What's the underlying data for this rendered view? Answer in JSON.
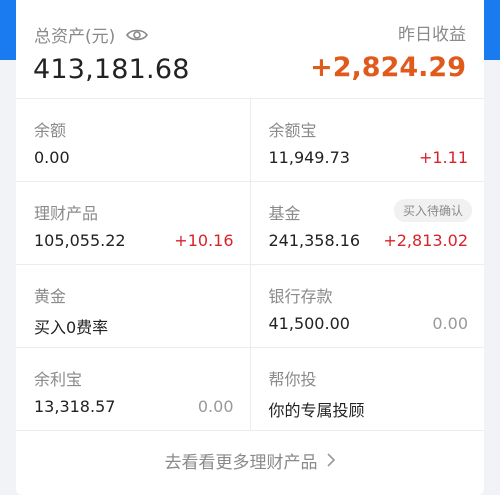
{
  "summary": {
    "total_label": "总资产(元)",
    "total_value": "413,181.68",
    "yesterday_label": "昨日收益",
    "yesterday_value": "+2,824.29"
  },
  "items": [
    {
      "name": "余额",
      "value": "0.00",
      "change": "",
      "change_type": "none"
    },
    {
      "name": "余额宝",
      "value": "11,949.73",
      "change": "+1.11",
      "change_type": "up"
    },
    {
      "name": "理财产品",
      "value": "105,055.22",
      "change": "+10.16",
      "change_type": "up"
    },
    {
      "name": "基金",
      "value": "241,358.16",
      "change": "+2,813.02",
      "change_type": "up",
      "badge": "买入待确认"
    },
    {
      "name": "黄金",
      "value": "买入0费率",
      "change": "",
      "change_type": "none"
    },
    {
      "name": "银行存款",
      "value": "41,500.00",
      "change": "0.00",
      "change_type": "flat"
    },
    {
      "name": "余利宝",
      "value": "13,318.57",
      "change": "0.00",
      "change_type": "flat"
    },
    {
      "name": "帮你投",
      "value": "你的专属投顾",
      "change": "",
      "change_type": "none"
    }
  ],
  "more_link": "去看看更多理财产品",
  "icons": {
    "eye": "eye-icon",
    "chevron": "chevron-right-icon"
  },
  "colors": {
    "accent_blue": "#1a7bf0",
    "gain_orange": "#e05a1c",
    "gain_red": "#d8232a"
  }
}
